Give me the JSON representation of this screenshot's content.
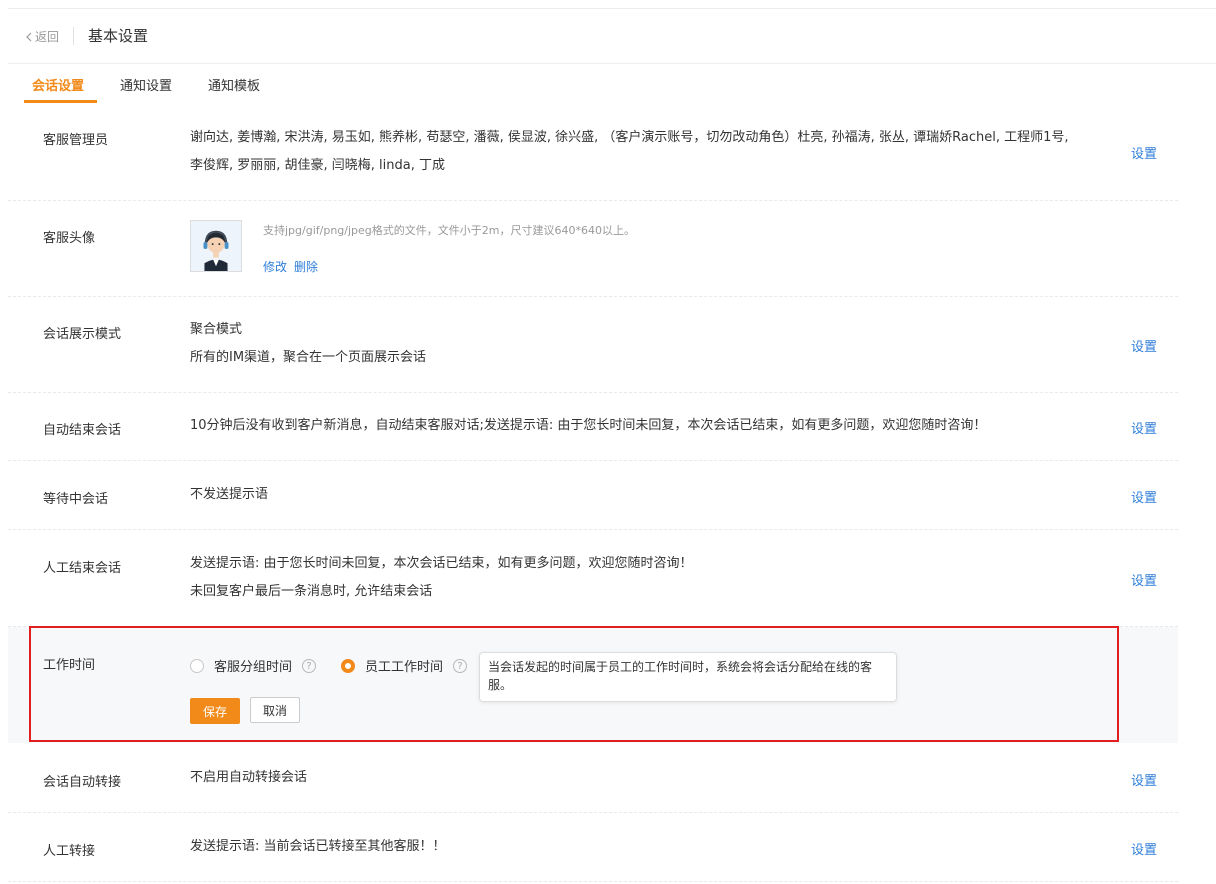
{
  "header": {
    "back_label": "返回",
    "title": "基本设置"
  },
  "tabs": [
    {
      "label": "会话设置",
      "active": true
    },
    {
      "label": "通知设置",
      "active": false
    },
    {
      "label": "通知模板",
      "active": false
    }
  ],
  "settings": {
    "admins": {
      "label": "客服管理员",
      "line1": "谢向达, 姜博瀚, 宋洪涛, 易玉如, 熊养彬, 苟瑟空, 潘薇, 侯显波, 徐兴盛, （客户演示账号，切勿改动角色）杜亮, 孙福涛, 张丛, 谭瑞娇Rachel, 工程师1号,",
      "line2": "李俊辉, 罗丽丽, 胡佳豪, 闫晓梅, linda, 丁成",
      "action": "设置"
    },
    "avatar": {
      "label": "客服头像",
      "hint": "支持jpg/gif/png/jpeg格式的文件，文件小于2m，尺寸建议640*640以上。",
      "edit": "修改",
      "delete": "删除"
    },
    "display_mode": {
      "label": "会话展示模式",
      "line1": "聚合模式",
      "line2": "所有的IM渠道，聚合在一个页面展示会话",
      "action": "设置"
    },
    "auto_end": {
      "label": "自动结束会话",
      "text": "10分钟后没有收到客户新消息，自动结束客服对话;发送提示语: 由于您长时间未回复，本次会话已结束，如有更多问题，欢迎您随时咨询！",
      "action": "设置"
    },
    "waiting": {
      "label": "等待中会话",
      "text": "不发送提示语",
      "action": "设置"
    },
    "manual_end": {
      "label": "人工结束会话",
      "line1": "发送提示语: 由于您长时间未回复，本次会话已结束，如有更多问题，欢迎您随时咨询！",
      "line2": "未回复客户最后一条消息时, 允许结束会话",
      "action": "设置"
    },
    "work_time": {
      "label": "工作时间",
      "option1": "客服分组时间",
      "option2": "员工工作时间",
      "selected": "员工工作时间",
      "tooltip": "当会话发起的时间属于员工的工作时间时，系统会将会话分配给在线的客服。",
      "save": "保存",
      "cancel": "取消"
    },
    "auto_transfer": {
      "label": "会话自动转接",
      "text": "不启用自动转接会话",
      "action": "设置"
    },
    "manual_transfer": {
      "label": "人工转接",
      "text": "发送提示语: 当前会话已转接至其他客服！！",
      "action": "设置"
    }
  },
  "colors": {
    "accent": "#f28a19",
    "link": "#2f7ed8",
    "highlight_border": "#e02020"
  }
}
